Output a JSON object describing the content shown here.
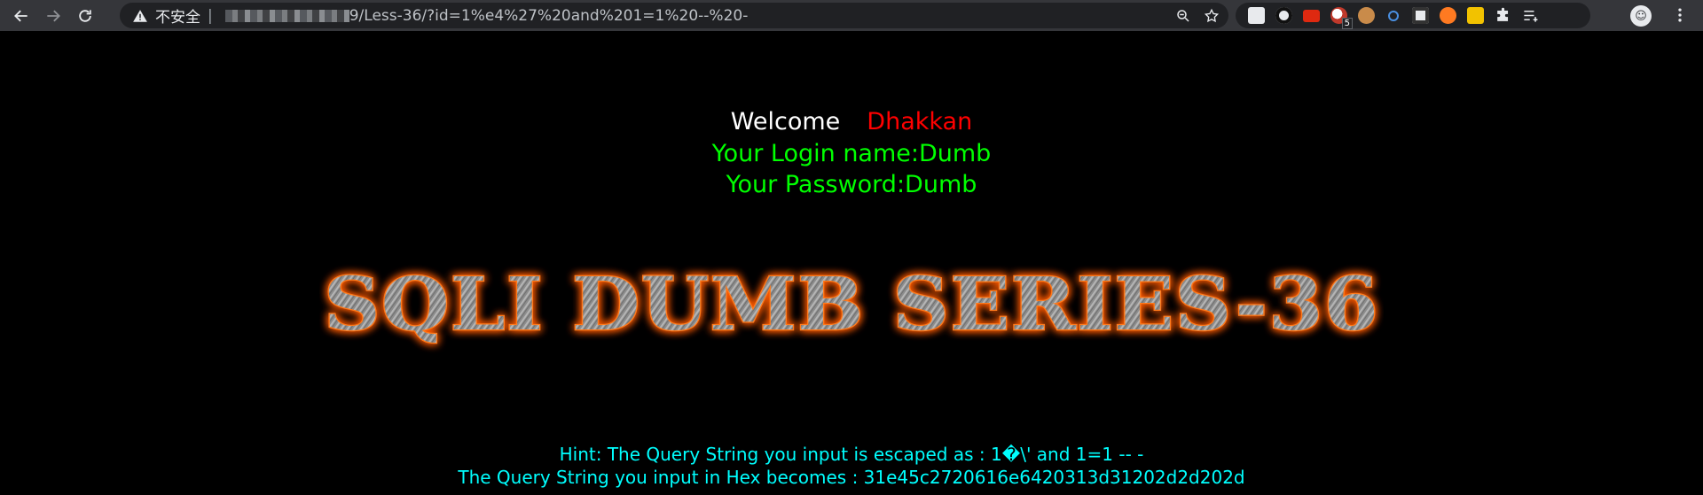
{
  "browser": {
    "security_label": "不安全",
    "url_path": "9/Less-36/?id=1%e4%27%20and%201=1%20--%20-",
    "extensions": [
      {
        "name": "ext-1",
        "color": "#e8eaed"
      },
      {
        "name": "ext-2",
        "color": "#111111"
      },
      {
        "name": "ext-3",
        "color": "#de2910"
      },
      {
        "name": "ext-4",
        "color": "#e8eaed",
        "badge": "5"
      },
      {
        "name": "ext-5",
        "color": "#c98b4a"
      },
      {
        "name": "ext-6",
        "color": "#4a90e2"
      },
      {
        "name": "ext-7",
        "color": "#e8eaed"
      },
      {
        "name": "ext-8",
        "color": "#ff7a21"
      },
      {
        "name": "ext-9",
        "color": "#f2c200"
      }
    ]
  },
  "page": {
    "welcome": "Welcome",
    "user_name": "Dhakkan",
    "login_name": "Your Login name:Dumb",
    "password": "Your Password:Dumb",
    "banner_text": "SQLI DUMB SERIES-36",
    "hint": "Hint: The Query String you input is escaped as : 1�\\' and 1=1 -- -",
    "hex": "The Query String you input in Hex becomes : 31e45c2720616e6420313d31202d2d202d"
  },
  "colors": {
    "welcome": "#ffffff",
    "user_name": "#ff0000",
    "info": "#00ff00",
    "hint": "#00ffff",
    "banner_glow": "#ff6a00"
  }
}
